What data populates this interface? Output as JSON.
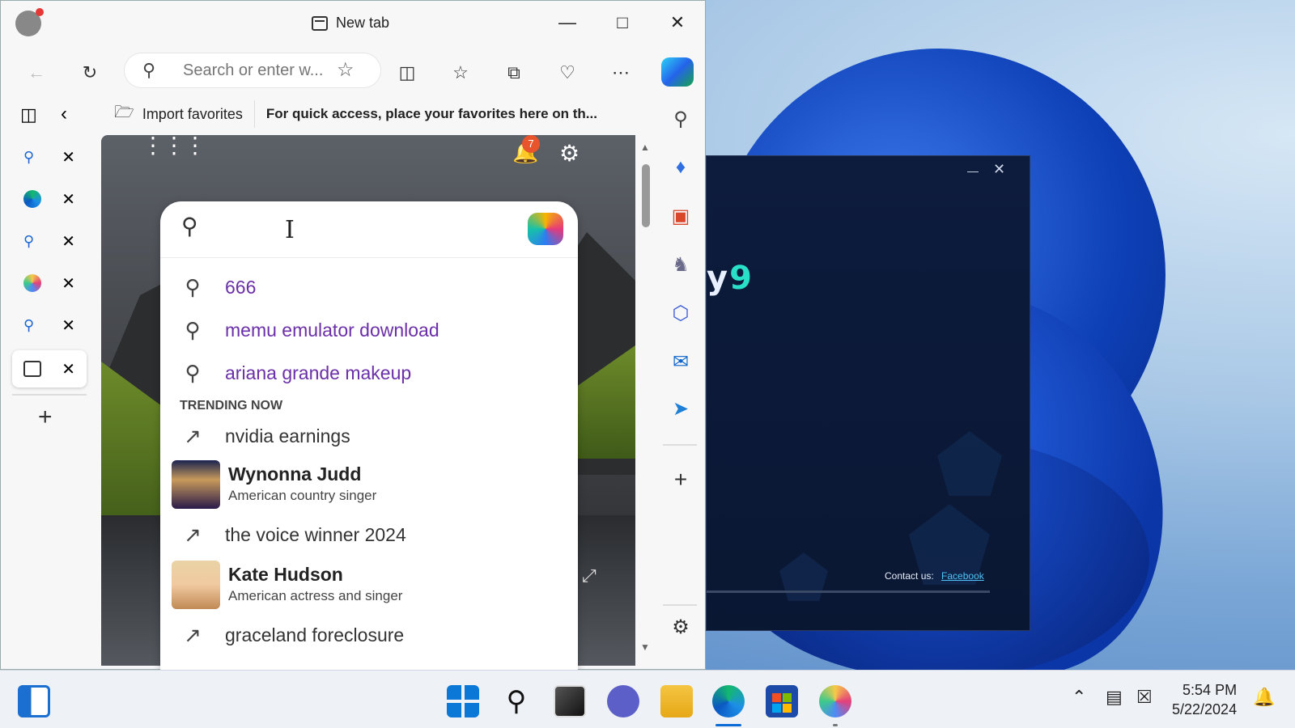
{
  "browser": {
    "tab_title": "New tab",
    "address_placeholder": "Search or enter w...",
    "import_favorites": "Import favorites",
    "favbar_hint": "For quick access, place your favorites here on th..."
  },
  "page": {
    "notification_count": "7",
    "suggestions": [
      "666",
      "memu emulator download",
      "ariana grande makeup"
    ],
    "trending_header": "TRENDING NOW",
    "trending": [
      {
        "type": "trend",
        "text": "nvidia earnings"
      },
      {
        "type": "entity",
        "name": "Wynonna Judd",
        "sub": "American country singer"
      },
      {
        "type": "trend",
        "text": "the voice winner 2024"
      },
      {
        "type": "entity",
        "name": "Kate Hudson",
        "sub": "American actress and singer"
      },
      {
        "type": "trend",
        "text": "graceland foreclosure"
      }
    ]
  },
  "app_window": {
    "logo_fragment": "y",
    "logo_number": "9",
    "contact_label": "Contact us:",
    "contact_link": "Facebook"
  },
  "taskbar": {
    "time": "5:54 PM",
    "date": "5/22/2024"
  },
  "colors": {
    "suggestion_text": "#6b2fa8",
    "notification_badge": "#e8552d",
    "app_logo_accent": "#28e0c8",
    "link": "#4fc3f7"
  }
}
